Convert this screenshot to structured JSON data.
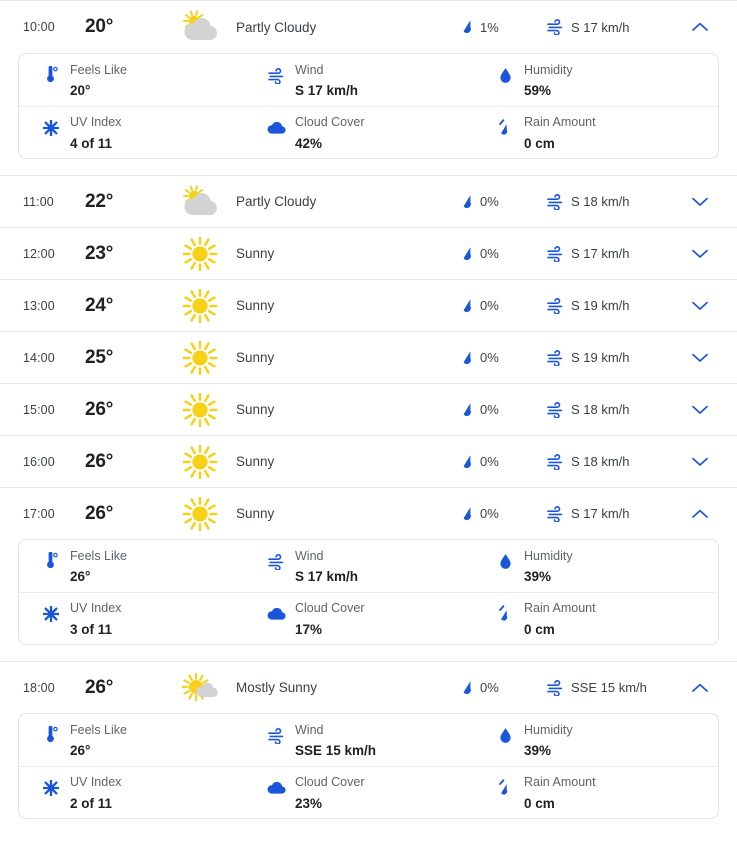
{
  "theme": {
    "accent_blue": "#1a56db",
    "sun_yellow": "#f7d117",
    "cloud_grey": "#d3d3d3",
    "text_dark": "#202124",
    "text_muted": "#5f6368"
  },
  "detail_labels": {
    "feels_like": "Feels Like",
    "wind": "Wind",
    "humidity": "Humidity",
    "uv_index": "UV Index",
    "cloud_cover": "Cloud Cover",
    "rain_amount": "Rain Amount"
  },
  "hours": [
    {
      "time": "10:00",
      "temp": "20°",
      "condition": "Partly Cloudy",
      "icon": "partly-cloudy-icon",
      "precip": "1%",
      "wind": "S 17 km/h",
      "expanded": true,
      "chevron": "chevron-up-icon",
      "details": {
        "feels_like": "20°",
        "wind": "S 17 km/h",
        "humidity": "59%",
        "uv_index": "4 of 11",
        "cloud_cover": "42%",
        "rain_amount": "0 cm"
      }
    },
    {
      "time": "11:00",
      "temp": "22°",
      "condition": "Partly Cloudy",
      "icon": "partly-cloudy-icon",
      "precip": "0%",
      "wind": "S 18 km/h",
      "expanded": false,
      "chevron": "chevron-down-icon"
    },
    {
      "time": "12:00",
      "temp": "23°",
      "condition": "Sunny",
      "icon": "sunny-icon",
      "precip": "0%",
      "wind": "S 17 km/h",
      "expanded": false,
      "chevron": "chevron-down-icon"
    },
    {
      "time": "13:00",
      "temp": "24°",
      "condition": "Sunny",
      "icon": "sunny-icon",
      "precip": "0%",
      "wind": "S 19 km/h",
      "expanded": false,
      "chevron": "chevron-down-icon"
    },
    {
      "time": "14:00",
      "temp": "25°",
      "condition": "Sunny",
      "icon": "sunny-icon",
      "precip": "0%",
      "wind": "S 19 km/h",
      "expanded": false,
      "chevron": "chevron-down-icon"
    },
    {
      "time": "15:00",
      "temp": "26°",
      "condition": "Sunny",
      "icon": "sunny-icon",
      "precip": "0%",
      "wind": "S 18 km/h",
      "expanded": false,
      "chevron": "chevron-down-icon"
    },
    {
      "time": "16:00",
      "temp": "26°",
      "condition": "Sunny",
      "icon": "sunny-icon",
      "precip": "0%",
      "wind": "S 18 km/h",
      "expanded": false,
      "chevron": "chevron-down-icon"
    },
    {
      "time": "17:00",
      "temp": "26°",
      "condition": "Sunny",
      "icon": "sunny-icon",
      "precip": "0%",
      "wind": "S 17 km/h",
      "expanded": true,
      "chevron": "chevron-up-icon",
      "details": {
        "feels_like": "26°",
        "wind": "S 17 km/h",
        "humidity": "39%",
        "uv_index": "3 of 11",
        "cloud_cover": "17%",
        "rain_amount": "0 cm"
      }
    },
    {
      "time": "18:00",
      "temp": "26°",
      "condition": "Mostly Sunny",
      "icon": "mostly-sunny-icon",
      "precip": "0%",
      "wind": "SSE 15 km/h",
      "expanded": true,
      "chevron": "chevron-up-icon",
      "details": {
        "feels_like": "26°",
        "wind": "SSE 15 km/h",
        "humidity": "39%",
        "uv_index": "2 of 11",
        "cloud_cover": "23%",
        "rain_amount": "0 cm"
      }
    }
  ]
}
